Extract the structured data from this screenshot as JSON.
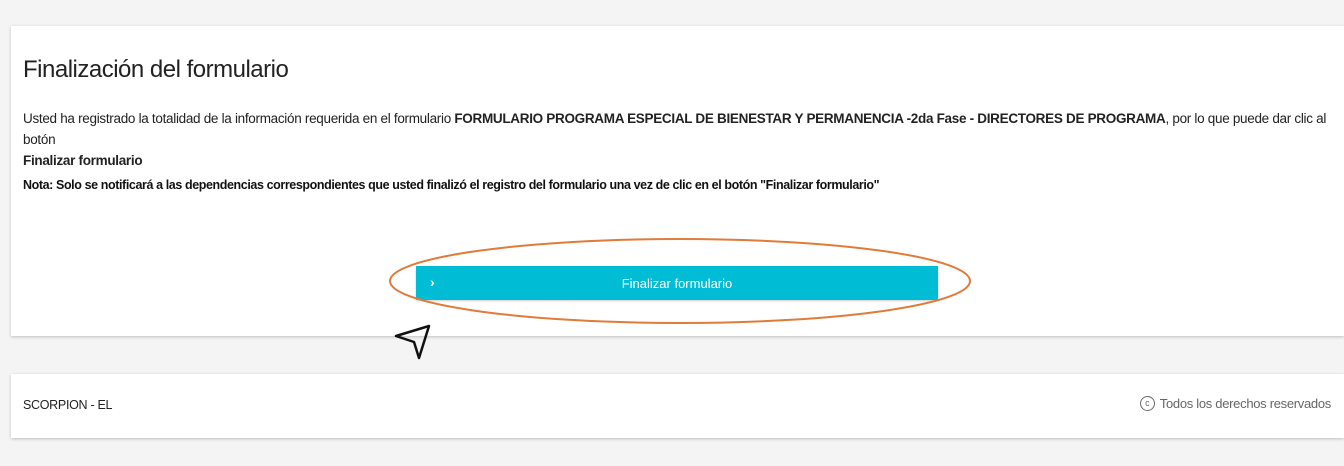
{
  "form_card": {
    "title": "Finalización del formulario",
    "message_intro": "Usted ha registrado la totalidad de la información requerida en el formulario ",
    "form_name": "FORMULARIO PROGRAMA ESPECIAL DE BIENESTAR Y PERMANENCIA -2da Fase - DIRECTORES DE PROGRAMA",
    "message_mid": ", por lo que puede dar clic al botón ",
    "button_ref": "Finalizar formulario",
    "note": "Nota: Solo se notificará a las dependencias correspondientes que usted finalizó el registro del formulario una vez de clic en el botón \"Finalizar formulario\"",
    "finish_button_label": "Finalizar formulario",
    "finish_button_icon": "chevron-right-icon"
  },
  "annotation": {
    "highlight_color": "#e07b39",
    "cursor_icon": "pointer-arrow-icon"
  },
  "footer": {
    "brand": "SCORPION - EL",
    "rights_icon": "copyright-icon",
    "rights": "Todos los derechos reservados"
  },
  "colors": {
    "accent": "#00bcd4",
    "background": "#f4f4f4"
  }
}
